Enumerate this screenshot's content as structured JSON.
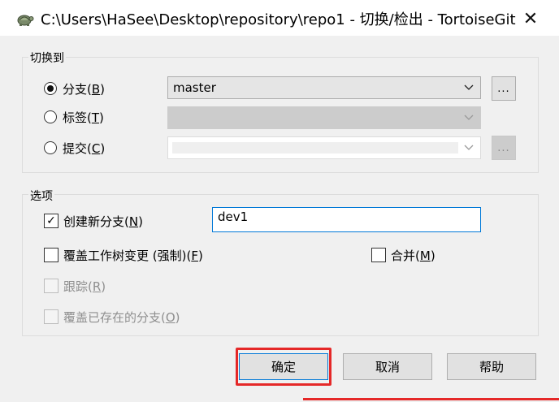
{
  "window": {
    "title": "C:\\Users\\HaSee\\Desktop\\repository\\repo1 - 切换/检出 - TortoiseGit",
    "close_glyph": "✕"
  },
  "switch_to": {
    "label": "切换到",
    "branch": {
      "text": "分支(",
      "key": "B",
      "end": ")",
      "selected": true,
      "value": "master"
    },
    "tag": {
      "text": "标签(",
      "key": "T",
      "end": ")",
      "selected": false,
      "value": ""
    },
    "commit": {
      "text": "提交(",
      "key": "C",
      "end": ")",
      "selected": false,
      "value": ""
    },
    "browse_glyph": "..."
  },
  "options": {
    "label": "选项",
    "create_branch": {
      "text": "创建新分支(",
      "key": "N",
      "end": ")",
      "checked": true,
      "value": "dev1"
    },
    "override_changes": {
      "text": "覆盖工作树变更 (强制)(",
      "key": "F",
      "end": ")",
      "checked": false
    },
    "merge": {
      "text": "合并(",
      "key": "M",
      "end": ")",
      "checked": false
    },
    "track": {
      "text": "跟踪(",
      "key": "R",
      "end": ")",
      "checked": false
    },
    "override_branch": {
      "text": "覆盖已存在的分支(",
      "key": "O",
      "end": ")",
      "checked": false
    },
    "check_glyph": "✓"
  },
  "buttons": {
    "ok": "确定",
    "cancel": "取消",
    "help": "帮助"
  },
  "colors": {
    "highlight": "#e52828",
    "accent": "#0078d7"
  }
}
